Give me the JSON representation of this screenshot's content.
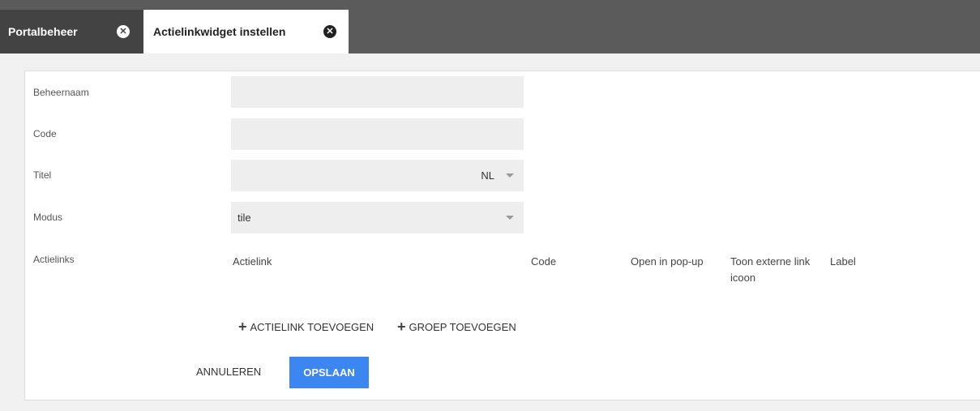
{
  "tabs": [
    {
      "label": "Portalbeheer",
      "close_icon": "✕"
    },
    {
      "label": "Actielinkwidget instellen",
      "close_icon": "✕"
    }
  ],
  "form": {
    "beheernaam_label": "Beheernaam",
    "beheernaam_value": "",
    "code_label": "Code",
    "code_value": "",
    "titel_label": "Titel",
    "titel_value": "",
    "titel_lang": "NL",
    "modus_label": "Modus",
    "modus_value": "tile",
    "actielinks_label": "Actielinks"
  },
  "actielinks_table": {
    "columns": [
      "Actielink",
      "Code",
      "Open in pop-up",
      "Toon externe link icoon",
      "Label"
    ]
  },
  "actions": {
    "add_actielink": "ACTIELINK TOEVOEGEN",
    "add_groep": "GROEP TOEVOEGEN",
    "cancel": "ANNULEREN",
    "save": "OPSLAAN"
  },
  "colors": {
    "tabbar": "#5b5b5b",
    "inactive_tab": "#434343",
    "primary_button": "#3b86f0",
    "field_bg": "#eeeeee"
  }
}
